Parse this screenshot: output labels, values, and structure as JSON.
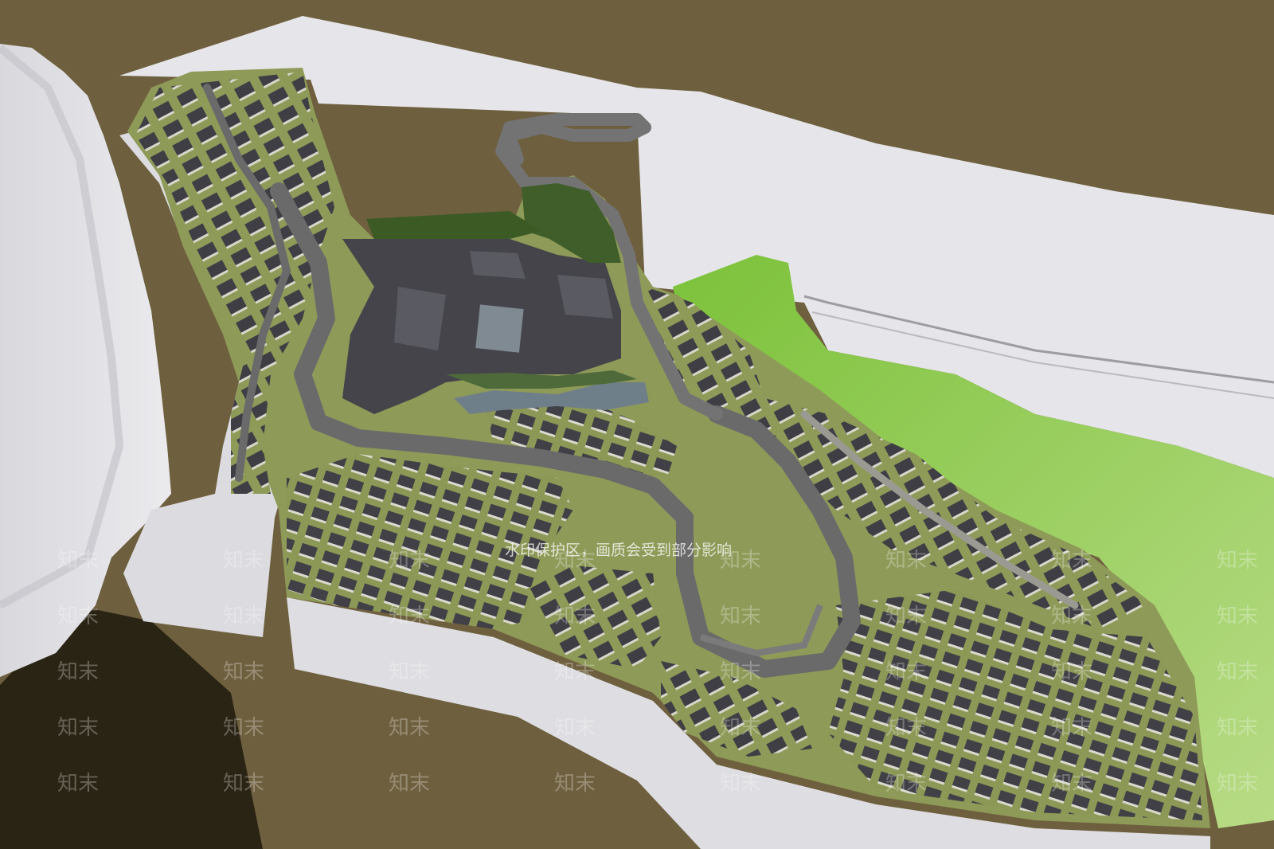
{
  "scene": {
    "description_label": "",
    "palette": {
      "ground": "#6e5f3e",
      "shadow": "#2a2414",
      "terrain_white": "#e4e4e8",
      "terrain_shade": "#c9c9cf",
      "lawn": "#8fbf47",
      "lawn_bright": "#7cc23a",
      "grass_site": "#8e9a58",
      "road": "#6a6a6a",
      "roof": "#3e3e44",
      "water": "#6f7f8a"
    }
  },
  "watermark": {
    "brand": "知末",
    "notice": "水印保护区，画质会受到部分影响"
  }
}
